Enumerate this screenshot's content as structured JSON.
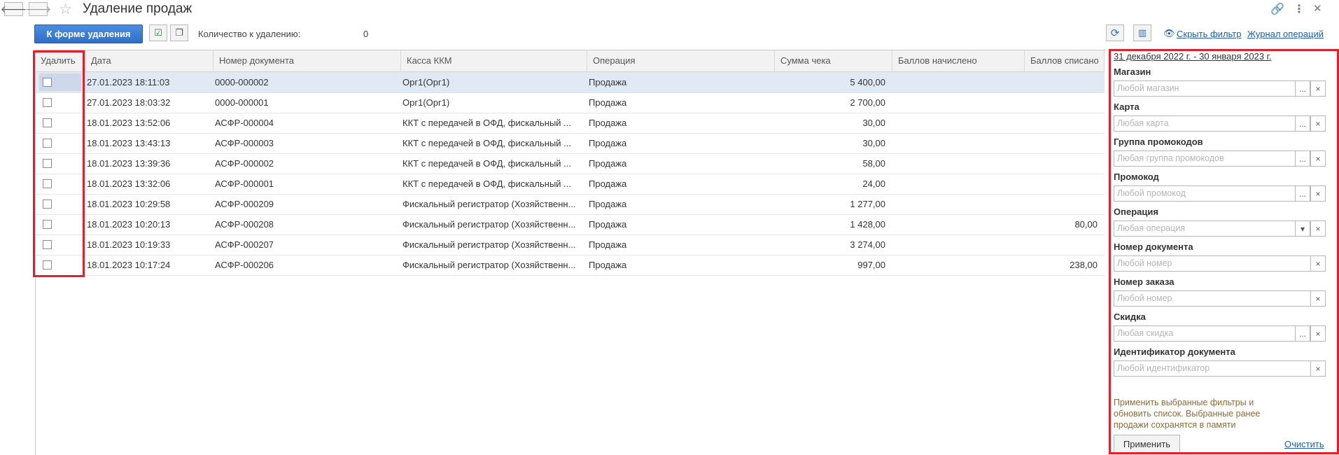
{
  "window": {
    "title": "Удаление продаж",
    "back_icon": "arrow-left-icon",
    "forward_icon": "arrow-right-icon",
    "favorite_icon": "star-icon",
    "link_icon": "link-icon",
    "more_icon": "more-vertical-icon",
    "close_icon": "close-icon"
  },
  "toolbar": {
    "primary_button": "К форме удаления",
    "count_label": "Количество к удалению:",
    "count_value": "0",
    "hide_filter": "Скрыть фильтр",
    "operations_log": "Журнал операций"
  },
  "table": {
    "columns": [
      "Удалить",
      "Дата",
      "Номер документа",
      "Касса ККМ",
      "Операция",
      "Сумма чека",
      "Баллов начислено",
      "Баллов списано"
    ],
    "rows": [
      {
        "date": "27.01.2023 18:11:03",
        "doc": "0000-000002",
        "kkm": "Орг1(Орг1)",
        "op": "Продажа",
        "sum": "5 400,00",
        "accrued": "",
        "spent": ""
      },
      {
        "date": "27.01.2023 18:03:32",
        "doc": "0000-000001",
        "kkm": "Орг1(Орг1)",
        "op": "Продажа",
        "sum": "2 700,00",
        "accrued": "",
        "spent": ""
      },
      {
        "date": "18.01.2023 13:52:06",
        "doc": "АСФР-000004",
        "kkm": "ККТ с передачей в ОФД, фискальный ...",
        "op": "Продажа",
        "sum": "30,00",
        "accrued": "",
        "spent": ""
      },
      {
        "date": "18.01.2023 13:43:13",
        "doc": "АСФР-000003",
        "kkm": "ККТ с передачей в ОФД, фискальный ...",
        "op": "Продажа",
        "sum": "30,00",
        "accrued": "",
        "spent": ""
      },
      {
        "date": "18.01.2023 13:39:36",
        "doc": "АСФР-000002",
        "kkm": "ККТ с передачей в ОФД, фискальный ...",
        "op": "Продажа",
        "sum": "58,00",
        "accrued": "",
        "spent": ""
      },
      {
        "date": "18.01.2023 13:32:06",
        "doc": "АСФР-000001",
        "kkm": "ККТ с передачей в ОФД, фискальный ...",
        "op": "Продажа",
        "sum": "24,00",
        "accrued": "",
        "spent": ""
      },
      {
        "date": "18.01.2023 10:29:58",
        "doc": "АСФР-000209",
        "kkm": "Фискальный регистратор (Хозяйственн...",
        "op": "Продажа",
        "sum": "1 277,00",
        "accrued": "",
        "spent": ""
      },
      {
        "date": "18.01.2023 10:20:13",
        "doc": "АСФР-000208",
        "kkm": "Фискальный регистратор (Хозяйственн...",
        "op": "Продажа",
        "sum": "1 428,00",
        "accrued": "",
        "spent": "80,00"
      },
      {
        "date": "18.01.2023 10:19:33",
        "doc": "АСФР-000207",
        "kkm": "Фискальный регистратор (Хозяйственн...",
        "op": "Продажа",
        "sum": "3 274,00",
        "accrued": "",
        "spent": ""
      },
      {
        "date": "18.01.2023 10:17:24",
        "doc": "АСФР-000206",
        "kkm": "Фискальный регистратор (Хозяйственн...",
        "op": "Продажа",
        "sum": "997,00",
        "accrued": "",
        "spent": "238,00"
      }
    ]
  },
  "filter": {
    "period": "31 декабря 2022 г. - 30 января 2023 г.",
    "fields": [
      {
        "label": "Магазин",
        "placeholder": "Любой магазин",
        "select": "...",
        "clear": "×"
      },
      {
        "label": "Карта",
        "placeholder": "Любая карта",
        "select": "...",
        "clear": "×"
      },
      {
        "label": "Группа промокодов",
        "placeholder": "Любая группа промокодов",
        "select": "...",
        "clear": "×"
      },
      {
        "label": "Промокод",
        "placeholder": "Любой промокод",
        "select": "...",
        "clear": "×"
      },
      {
        "label": "Операция",
        "placeholder": "Любая операция",
        "select": "▾",
        "clear": "×"
      },
      {
        "label": "Номер документа",
        "placeholder": "Любой номер",
        "clear": "×"
      },
      {
        "label": "Номер заказа",
        "placeholder": "Любой номер",
        "clear": "×"
      },
      {
        "label": "Скидка",
        "placeholder": "Любая скидка",
        "select": "...",
        "clear": "×"
      },
      {
        "label": "Идентификатор документа",
        "placeholder": "Любой идентификатор",
        "clear": "×"
      }
    ],
    "hint": "Применить выбранные фильтры и обновить список. Выбранные ранее продажи сохранятся в памяти",
    "apply": "Применить",
    "clear_all": "Очистить"
  },
  "colors": {
    "primary": "#2f6fc9",
    "highlight": "#e0202c",
    "link": "#1a5fb4",
    "hint": "#8a6a3a"
  }
}
